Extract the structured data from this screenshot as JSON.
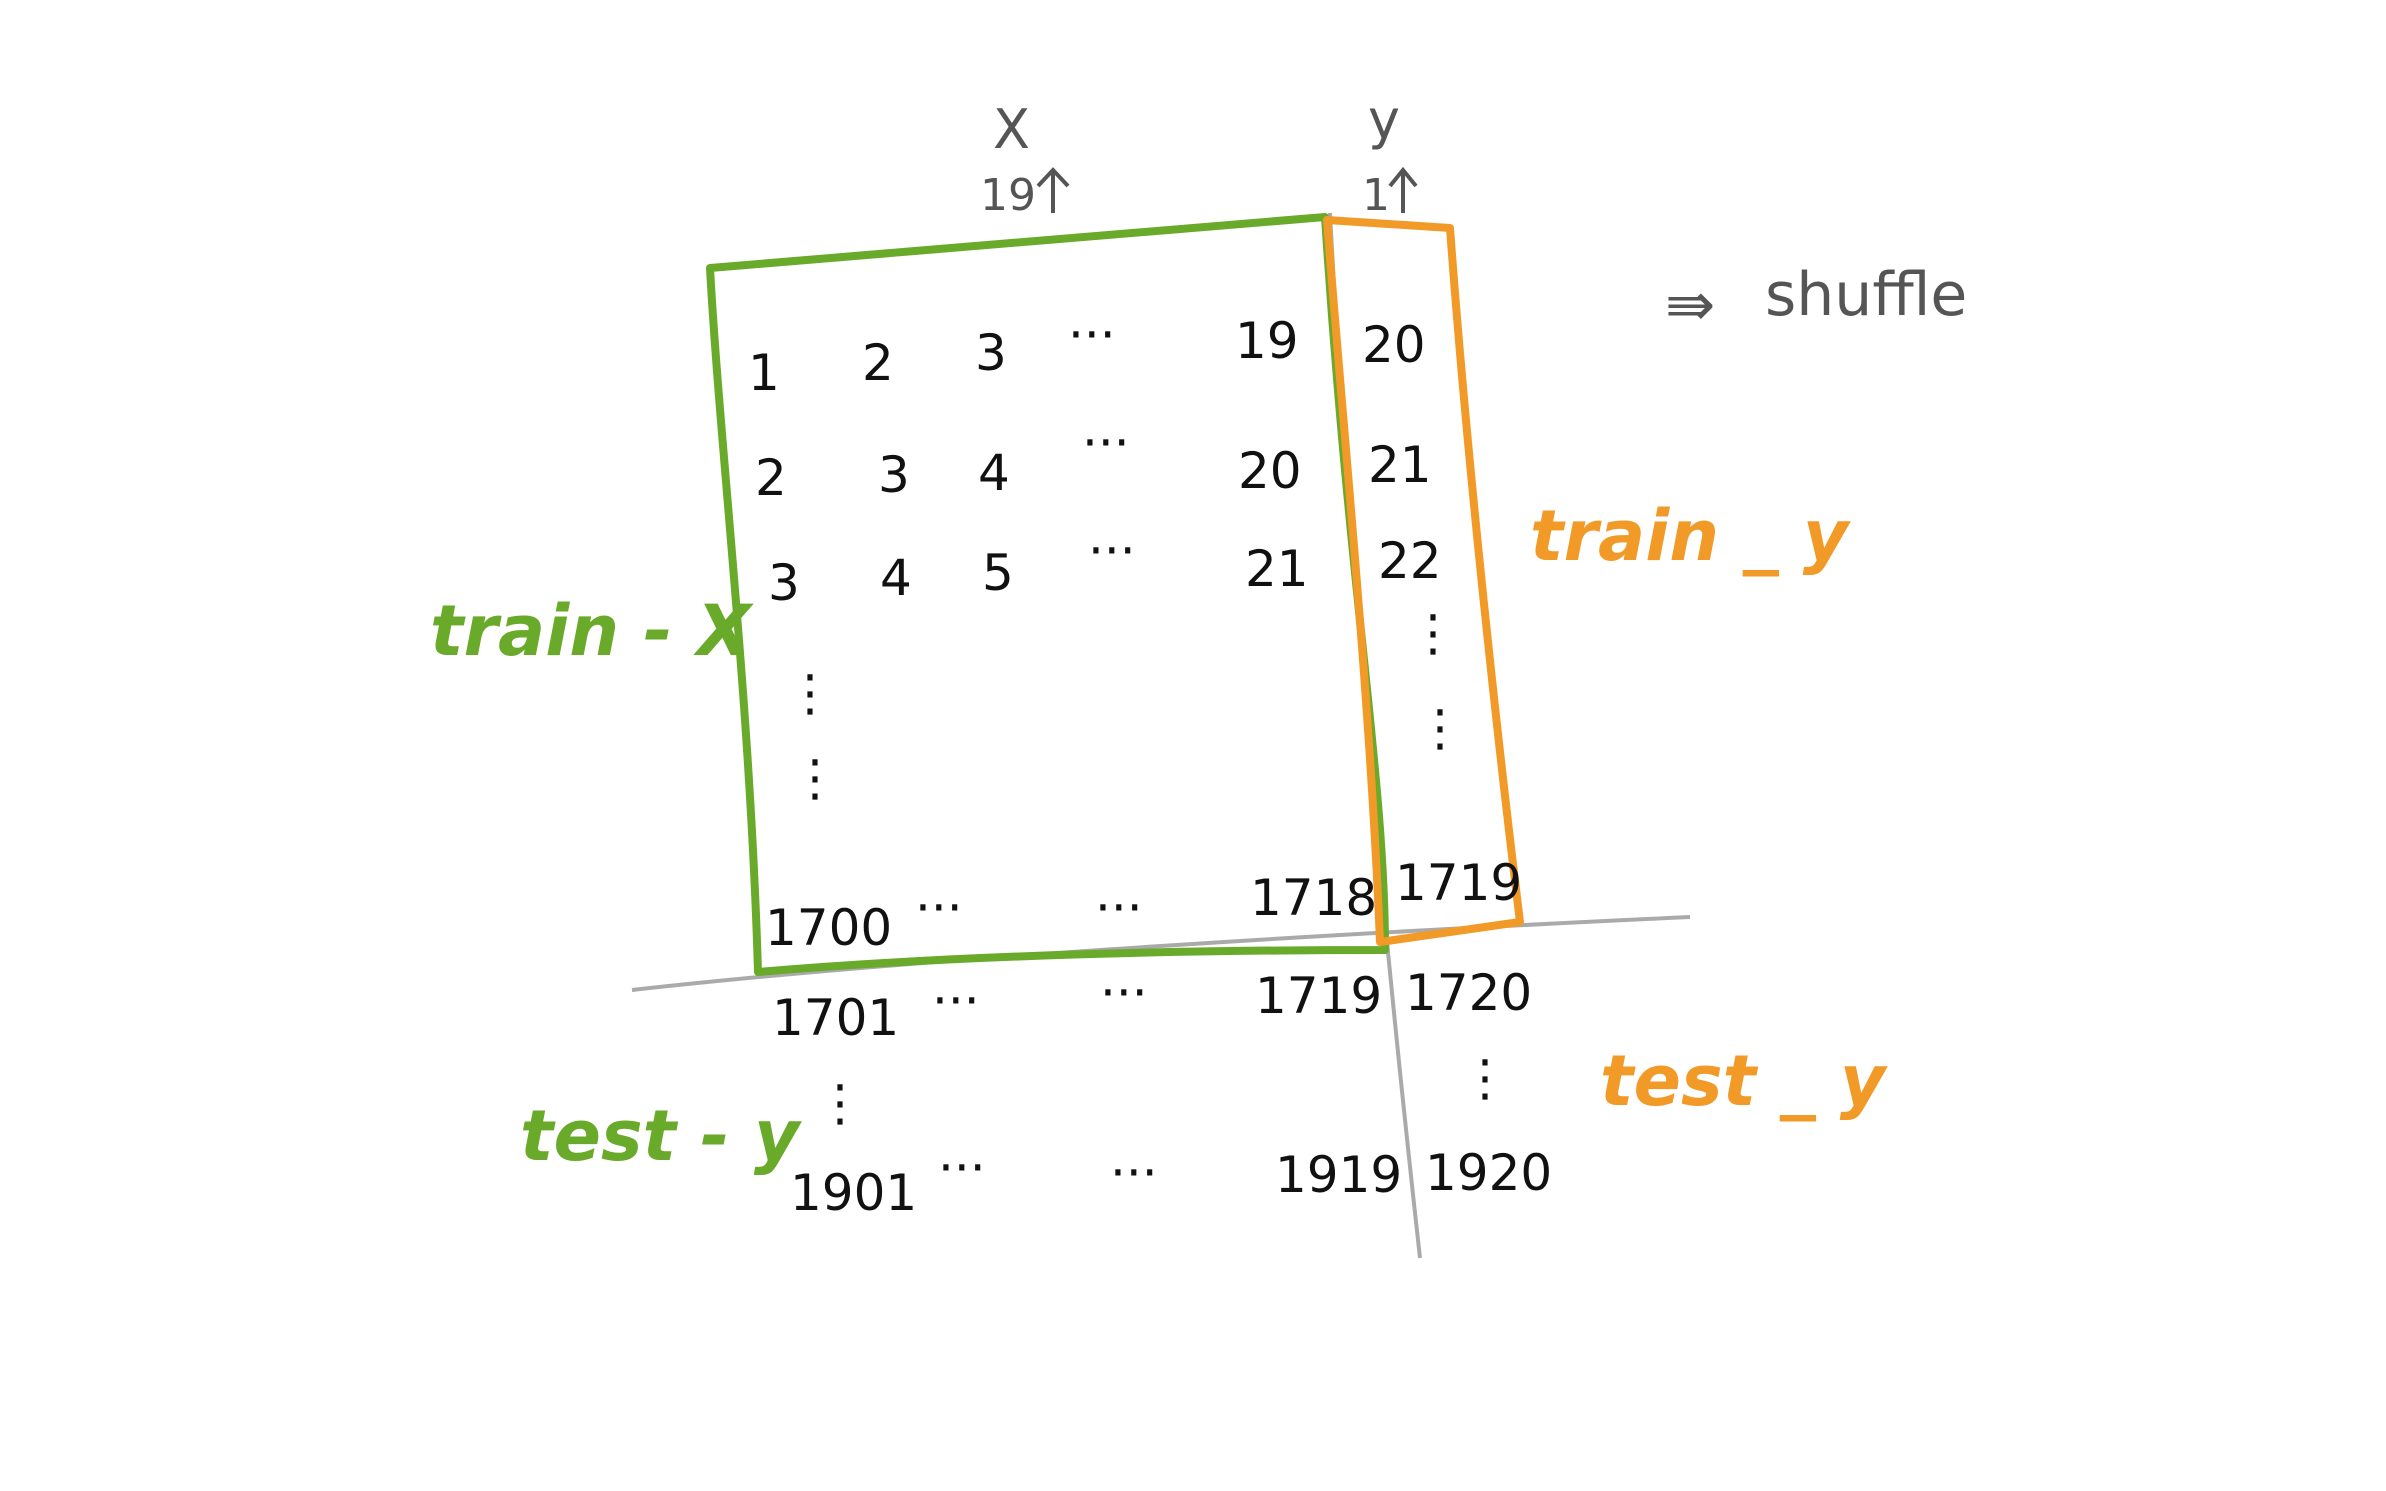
{
  "header": {
    "x_label": "X",
    "x_count": "19",
    "y_label": "y",
    "y_count": "1"
  },
  "note": {
    "arrow": "⇛",
    "text": "shuffle"
  },
  "labels": {
    "train_x": "train - X",
    "train_y": "train _ y",
    "test_x": "test - y",
    "test_y": "test _ y"
  },
  "grid": {
    "row1": [
      "1",
      "2",
      "3",
      "···",
      "19",
      "20"
    ],
    "row2": [
      "2",
      "3",
      "4",
      "···",
      "20",
      "21"
    ],
    "row3": [
      "3",
      "4",
      "5",
      "···",
      "21",
      "22"
    ],
    "row_last_train": [
      "1700",
      "···",
      "···",
      "1718",
      "1719"
    ],
    "row_first_test": [
      "1701",
      "···",
      "···",
      "1719",
      "1720"
    ],
    "row_last_test": [
      "1901",
      "···",
      "···",
      "1919",
      "1920"
    ]
  },
  "ellipsis": {
    "vertical": "⋮"
  },
  "colors": {
    "train_x": "#6aaa2a",
    "train_y": "#f29a27",
    "split_line": "#aaaaaa",
    "ink": "#111111"
  }
}
